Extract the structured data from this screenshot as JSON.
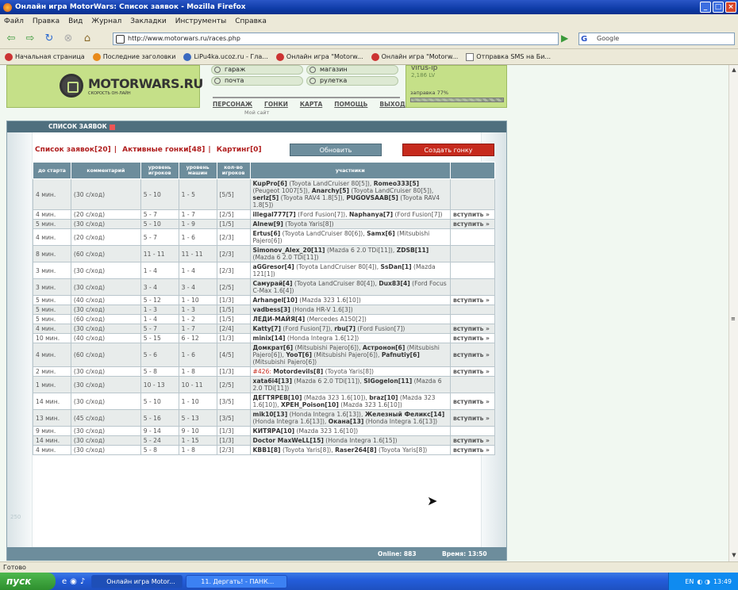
{
  "window": {
    "title": "Онлайн игра MotorWars: Список заявок - Mozilla Firefox"
  },
  "menubar": [
    "Файл",
    "Правка",
    "Вид",
    "Журнал",
    "Закладки",
    "Инструменты",
    "Справка"
  ],
  "navbar": {
    "url": "http://www.motorwars.ru/races.php",
    "search_placeholder": "Google"
  },
  "bookmarks": [
    "Начальная страница",
    "Последние заголовки",
    "LiPu4ka.ucoz.ru - Гла...",
    "Онлайн игра \"Motorw...",
    "Онлайн игра \"Motorw...",
    "Отправка SMS на Би..."
  ],
  "site": {
    "logo": "MOTORWARS.RU",
    "logo_sub": "СКОРОСТЬ ОН-ЛАЙН",
    "menu": {
      "garage": "гараж",
      "shop": "магазин",
      "mail": "почта",
      "roulette": "рулетка"
    },
    "nav": [
      "ПЕРСОНАЖ",
      "ГОНКИ",
      "КАРТА",
      "ПОМОЩЬ",
      "ВЫХОД"
    ],
    "my_site": "Мой сайт",
    "user": {
      "name": "virus-ip",
      "level": "2,186 LV",
      "fuel": "заправка 77%",
      "fuel_pct": 77
    }
  },
  "panel": {
    "title": "СПИСОК ЗАЯВОК",
    "tabs": [
      "Список заявок[20]",
      "Активные гонки[48]",
      "Картинг[0]"
    ],
    "refresh": "Обновить",
    "create": "Создать гонку",
    "headers": [
      "до старта",
      "комментарий",
      "уровень игроков",
      "уровень машин",
      "кол-во игроков",
      "участники",
      ""
    ],
    "online": "Online: 883",
    "time": "Время: 13:50"
  },
  "rows": [
    {
      "s": "4 мин.",
      "c": "(30 с/ход)",
      "pl": "5 - 10",
      "ml": "1 - 5",
      "n": "[5/5]",
      "p": [
        [
          "KupPro[6]",
          " (Toyota LandCruiser 80[5]), "
        ],
        [
          "Romeo333[5]",
          " (Peugeot 1007[5]), "
        ],
        [
          "Anarchy[5]",
          " (Toyota LandCruiser 80[5]), "
        ],
        [
          "serlz[5]",
          " (Toyota RAV4 1.8[5]), "
        ],
        [
          "PUGOVSAAB[5]",
          " (Toyota RAV4 1.8[5])"
        ]
      ],
      "j": ""
    },
    {
      "s": "4 мин.",
      "c": "(20 с/ход)",
      "pl": "5 - 7",
      "ml": "1 - 7",
      "n": "[2/5]",
      "p": [
        [
          "illegal777[7]",
          " (Ford Fusion[7]), "
        ],
        [
          "Naphanya[7]",
          " (Ford Fusion[7])"
        ]
      ],
      "j": "вступить »"
    },
    {
      "s": "5 мин.",
      "c": "(30 с/ход)",
      "pl": "5 - 10",
      "ml": "1 - 9",
      "n": "[1/5]",
      "p": [
        [
          "Alnew[9]",
          " (Toyota Yaris[8])"
        ]
      ],
      "j": "вступить »"
    },
    {
      "s": "4 мин.",
      "c": "(20 с/ход)",
      "pl": "5 - 7",
      "ml": "1 - 6",
      "n": "[2/3]",
      "p": [
        [
          "Ertus[6]",
          " (Toyota LandCruiser 80[6]), "
        ],
        [
          "Samx[6]",
          " (Mitsubishi Pajero[6])"
        ]
      ],
      "j": ""
    },
    {
      "s": "8 мин.",
      "c": "(60 с/ход)",
      "pl": "11 - 11",
      "ml": "11 - 11",
      "n": "[2/3]",
      "p": [
        [
          "Simonov_Alex_20[11]",
          " (Mazda 6 2.0 TDi[11]), "
        ],
        [
          "ZDSB[11]",
          " (Mazda 6 2.0 TDi[11])"
        ]
      ],
      "j": ""
    },
    {
      "s": "3 мин.",
      "c": "(30 с/ход)",
      "pl": "1 - 4",
      "ml": "1 - 4",
      "n": "[2/3]",
      "p": [
        [
          "aGGresor[4]",
          " (Toyota LandCruiser 80[4]), "
        ],
        [
          "SsDan[1]",
          " (Mazda 121[1])"
        ]
      ],
      "j": ""
    },
    {
      "s": "3 мин.",
      "c": "(30 с/ход)",
      "pl": "3 - 4",
      "ml": "3 - 4",
      "n": "[2/5]",
      "p": [
        [
          "Самурай[4]",
          " (Toyota LandCruiser 80[4]), "
        ],
        [
          "Dux83[4]",
          " (Ford Focus C-Max 1.6[4])"
        ]
      ],
      "j": ""
    },
    {
      "s": "5 мин.",
      "c": "(40 с/ход)",
      "pl": "5 - 12",
      "ml": "1 - 10",
      "n": "[1/3]",
      "p": [
        [
          "Arhangel[10]",
          " (Mazda 323 1.6[10])"
        ]
      ],
      "j": "вступить »"
    },
    {
      "s": "5 мин.",
      "c": "(30 с/ход)",
      "pl": "1 - 3",
      "ml": "1 - 3",
      "n": "[1/5]",
      "p": [
        [
          "vadbess[3]",
          " (Honda HR-V 1.6[3])"
        ]
      ],
      "j": ""
    },
    {
      "s": "5 мин.",
      "c": "(60 с/ход)",
      "pl": "1 - 4",
      "ml": "1 - 2",
      "n": "[1/5]",
      "p": [
        [
          "ЛЕДИ-МАЙЯ[4]",
          " (Mercedes A150[2])"
        ]
      ],
      "j": ""
    },
    {
      "s": "4 мин.",
      "c": "(30 с/ход)",
      "pl": "5 - 7",
      "ml": "1 - 7",
      "n": "[2/4]",
      "p": [
        [
          "Katty[7]",
          " (Ford Fusion[7]), "
        ],
        [
          "rbu[7]",
          " (Ford Fusion[7])"
        ]
      ],
      "j": "вступить »"
    },
    {
      "s": "10 мин.",
      "c": "(40 с/ход)",
      "pl": "5 - 15",
      "ml": "6 - 12",
      "n": "[1/3]",
      "p": [
        [
          "minix[14]",
          " (Honda Integra 1.6[12])"
        ]
      ],
      "j": "вступить »"
    },
    {
      "s": "4 мин.",
      "c": "(60 с/ход)",
      "pl": "5 - 6",
      "ml": "1 - 6",
      "n": "[4/5]",
      "p": [
        [
          "Домкрат[6]",
          " (Mitsubishi Pajero[6]), "
        ],
        [
          "Астронон[6]",
          " (Mitsubishi Pajero[6]), "
        ],
        [
          "YooT[6]",
          " (Mitsubishi Pajero[6]), "
        ],
        [
          "Pafnutiy[6]",
          " (Mitsubishi Pajero[6])"
        ]
      ],
      "j": "вступить »"
    },
    {
      "s": "2 мин.",
      "c": "(30 с/ход)",
      "pl": "5 - 8",
      "ml": "1 - 8",
      "n": "[1/3]",
      "red": "#426:",
      "p": [
        [
          "Motordevils[8]",
          " (Toyota Yaris[8])"
        ]
      ],
      "j": "вступить »"
    },
    {
      "s": "1 мин.",
      "c": "(30 с/ход)",
      "pl": "10 - 13",
      "ml": "10 - 11",
      "n": "[2/5]",
      "p": [
        [
          "xata6i4[13]",
          " (Mazda 6 2.0 TDi[11]), "
        ],
        [
          "SIGogelon[11]",
          " (Mazda 6 2.0 TDi[11])"
        ]
      ],
      "j": ""
    },
    {
      "s": "14 мин.",
      "c": "(30 с/ход)",
      "pl": "5 - 10",
      "ml": "1 - 10",
      "n": "[3/5]",
      "p": [
        [
          "ДЕГТЯРЕВ[10]",
          " (Mazda 323 1.6[10]), "
        ],
        [
          "braz[10]",
          " (Mazda 323 1.6[10]), "
        ],
        [
          "XPEH_Poison[10]",
          " (Mazda 323 1.6[10])"
        ]
      ],
      "j": "вступить »"
    },
    {
      "s": "13 мин.",
      "c": "(45 с/ход)",
      "pl": "5 - 16",
      "ml": "5 - 13",
      "n": "[3/5]",
      "p": [
        [
          "mik10[13]",
          " (Honda Integra 1.6[13]), "
        ],
        [
          "Железный Феликс[14]",
          " (Honda Integra 1.6[13]), "
        ],
        [
          "Окана[13]",
          " (Honda Integra 1.6[13])"
        ]
      ],
      "j": "вступить »"
    },
    {
      "s": "9 мин.",
      "c": "(30 с/ход)",
      "pl": "9 - 14",
      "ml": "9 - 10",
      "n": "[1/3]",
      "p": [
        [
          "КИТЯРА[10]",
          " (Mazda 323 1.6[10])"
        ]
      ],
      "j": ""
    },
    {
      "s": "14 мин.",
      "c": "(30 с/ход)",
      "pl": "5 - 24",
      "ml": "1 - 15",
      "n": "[1/3]",
      "p": [
        [
          "Doctor MaxWeLL[15]",
          " (Honda Integra 1.6[15])"
        ]
      ],
      "j": "вступить »"
    },
    {
      "s": "4 мин.",
      "c": "(30 с/ход)",
      "pl": "5 - 8",
      "ml": "1 - 8",
      "n": "[2/3]",
      "p": [
        [
          "KBB1[8]",
          " (Toyota Yaris[8]), "
        ],
        [
          "Raser264[8]",
          " (Toyota Yaris[8])"
        ]
      ],
      "j": "вступить »"
    }
  ],
  "status": "Готово",
  "taskbar": {
    "start": "пуск",
    "tasks": [
      "Онлайн игра Motor...",
      "11. Дергать! - ПАНК..."
    ],
    "lang": "EN",
    "clock": "13:49"
  }
}
